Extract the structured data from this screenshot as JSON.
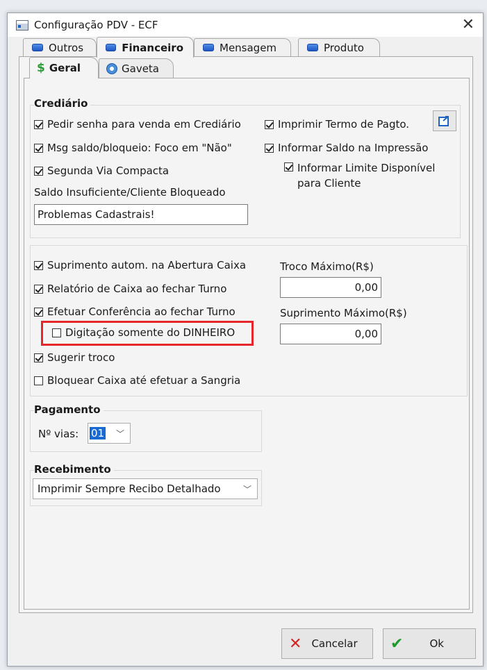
{
  "window": {
    "title": "Configuração PDV - ECF"
  },
  "tabs": {
    "outros": "Outros",
    "financeiro": "Financeiro",
    "mensagem": "Mensagem",
    "produto": "Produto"
  },
  "subtabs": {
    "geral": "Geral",
    "gaveta": "Gaveta"
  },
  "crediario": {
    "title": "Crediário",
    "pedir_senha": {
      "label": "Pedir senha para venda em Crediário",
      "checked": true
    },
    "msg_saldo": {
      "label": "Msg saldo/bloqueio: Foco em \"Não\"",
      "checked": true
    },
    "segunda_via": {
      "label": "Segunda Via Compacta",
      "checked": true
    },
    "imprimir_termo": {
      "label": "Imprimir Termo de Pagto.",
      "checked": true
    },
    "informar_saldo": {
      "label": "Informar Saldo na Impressão",
      "checked": true
    },
    "informar_limite": {
      "label_line1": "Informar Limite Disponível",
      "label_line2": "para Cliente",
      "checked": true
    },
    "saldo_label": "Saldo Insuficiente/Cliente Bloqueado",
    "saldo_value": "Problemas Cadastrais!"
  },
  "caixa": {
    "suprimento_autom": {
      "label": "Suprimento autom. na Abertura Caixa",
      "checked": true
    },
    "relatorio_caixa": {
      "label": "Relatório de Caixa ao fechar Turno",
      "checked": true
    },
    "efetuar_conferencia": {
      "label": "Efetuar Conferência ao fechar Turno",
      "checked": true
    },
    "digitacao_dinheiro": {
      "label": "Digitação somente do DINHEIRO",
      "checked": false
    },
    "sugerir_troco": {
      "label": "Sugerir troco",
      "checked": true
    },
    "bloquear_caixa": {
      "label": "Bloquear Caixa até efetuar a Sangria",
      "checked": false
    },
    "troco_label": "Troco Máximo(R$)",
    "troco_value": "0,00",
    "suprimento_label": "Suprimento Máximo(R$)",
    "suprimento_value": "0,00"
  },
  "pagamento": {
    "title": "Pagamento",
    "vias_label": "Nº vias:",
    "vias_value": "01"
  },
  "recebimento": {
    "title": "Recebimento",
    "value": "Imprimir Sempre Recibo Detalhado"
  },
  "buttons": {
    "cancel": "Cancelar",
    "ok": "Ok"
  },
  "colors": {
    "highlight": "#e5262a",
    "accent": "#1769d3"
  }
}
